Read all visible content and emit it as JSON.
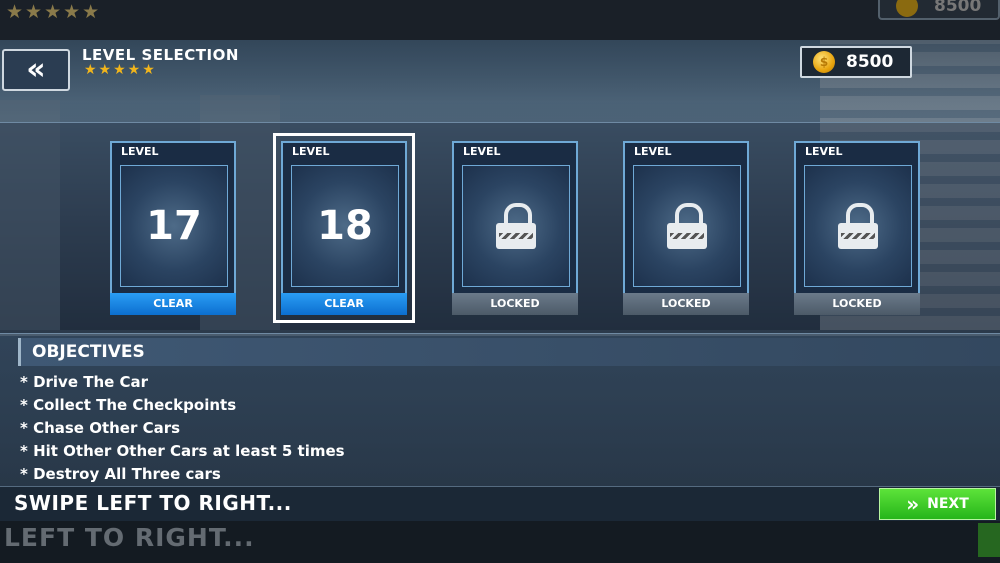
{
  "ghost": {
    "stars": "★★★★★",
    "coins": "8500",
    "swipe_text": "LEFT TO RIGHT..."
  },
  "header": {
    "back_icon": "«",
    "title": "LEVEL SELECTION",
    "stars": "★★★★★",
    "coins": "8500"
  },
  "levels": [
    {
      "label": "LEVEL",
      "number": "17",
      "status": "CLEAR"
    },
    {
      "label": "LEVEL",
      "number": "18",
      "status": "CLEAR",
      "selected": true
    },
    {
      "label": "LEVEL",
      "number": "",
      "status": "LOCKED"
    },
    {
      "label": "LEVEL",
      "number": "",
      "status": "LOCKED"
    },
    {
      "label": "LEVEL",
      "number": "",
      "status": "LOCKED"
    }
  ],
  "objectives": {
    "title": "OBJECTIVES",
    "items": [
      "* Drive The Car",
      "* Collect The Checkpoints",
      "* Chase Other Cars",
      "* Hit Other Other Cars at least 5 times",
      "* Destroy All Three cars"
    ]
  },
  "footer": {
    "swipe_text": "SWIPE LEFT TO RIGHT...",
    "next_label": "NEXT",
    "next_icon": "»"
  },
  "colors": {
    "accent_blue": "#2a9df4",
    "next_green": "#3fcf2a",
    "star_gold": "#f1b51c"
  }
}
